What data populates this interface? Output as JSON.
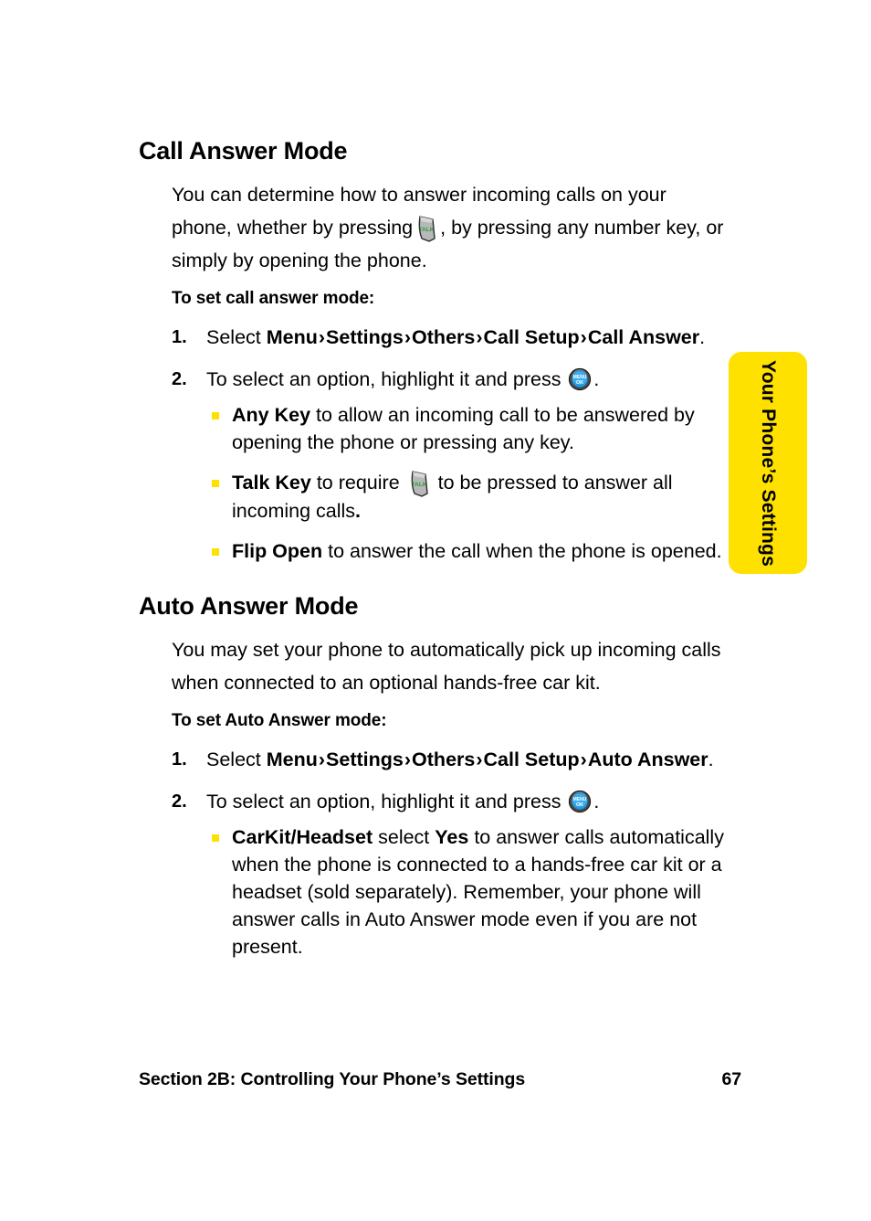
{
  "side_tab": {
    "label": "Your Phone’s Settings",
    "bg_color": "#FFE100",
    "text_color": "#000000"
  },
  "icons": {
    "talk_key": {
      "name": "talk-key-icon",
      "label": "TALK",
      "body_color": "#B3B3B3",
      "label_color": "#2E9B3C"
    },
    "menu_ok_key": {
      "name": "menu-ok-key-icon",
      "line1": "MENU",
      "line2": "OK",
      "ring_color": "#3A3A3A",
      "face_color": "#1E9BE8",
      "label_color": "#FFFFFF"
    }
  },
  "bullet_color": "#FFE100",
  "sections": [
    {
      "heading": "Call Answer Mode",
      "intro_a": "You can determine how to answer incoming calls on your phone, whether by pressing",
      "intro_b": ", by pressing any number key, or simply by opening the phone.",
      "lead_in": "To set call answer mode:",
      "steps": [
        {
          "num": "1.",
          "text_before": "Select ",
          "path": [
            "Menu",
            "Settings",
            "Others",
            "Call Setup",
            "Call Answer"
          ],
          "separator": "›",
          "text_after": "."
        },
        {
          "num": "2.",
          "text_before": "To select an option, highlight it and press ",
          "text_after": "."
        }
      ],
      "bullets": [
        {
          "term": "Any Key",
          "text": " to allow an incoming call to be answered by opening the phone or pressing any key."
        },
        {
          "term": "Talk Key",
          "text_before": " to require ",
          "text_after": " to be pressed to answer all incoming calls",
          "trailing_bold_period": "."
        },
        {
          "term": "Flip Open",
          "text": " to answer the call when the phone is opened."
        }
      ]
    },
    {
      "heading": "Auto Answer Mode",
      "intro": "You may set your phone to automatically pick up incoming calls when connected to an optional hands-free car kit.",
      "lead_in": "To set Auto Answer mode:",
      "steps": [
        {
          "num": "1.",
          "text_before": "Select ",
          "path": [
            "Menu",
            "Settings",
            "Others",
            "Call Setup",
            "Auto Answer"
          ],
          "separator": "›",
          "text_after": "."
        },
        {
          "num": "2.",
          "text_before": "To select an option, highlight it and press ",
          "text_after": "."
        }
      ],
      "bullets": [
        {
          "term": "CarKit/Headset",
          "text_mid_1": " select ",
          "term2": "Yes",
          "text_mid_2": " to answer calls automatically when the phone is connected to a hands-free car kit or a headset (sold separately). Remember, your phone will answer calls in Auto Answer mode even if you are not present."
        }
      ]
    }
  ],
  "footer": {
    "section_label": "Section 2B: Controlling Your Phone’s Settings",
    "page_number": "67"
  }
}
